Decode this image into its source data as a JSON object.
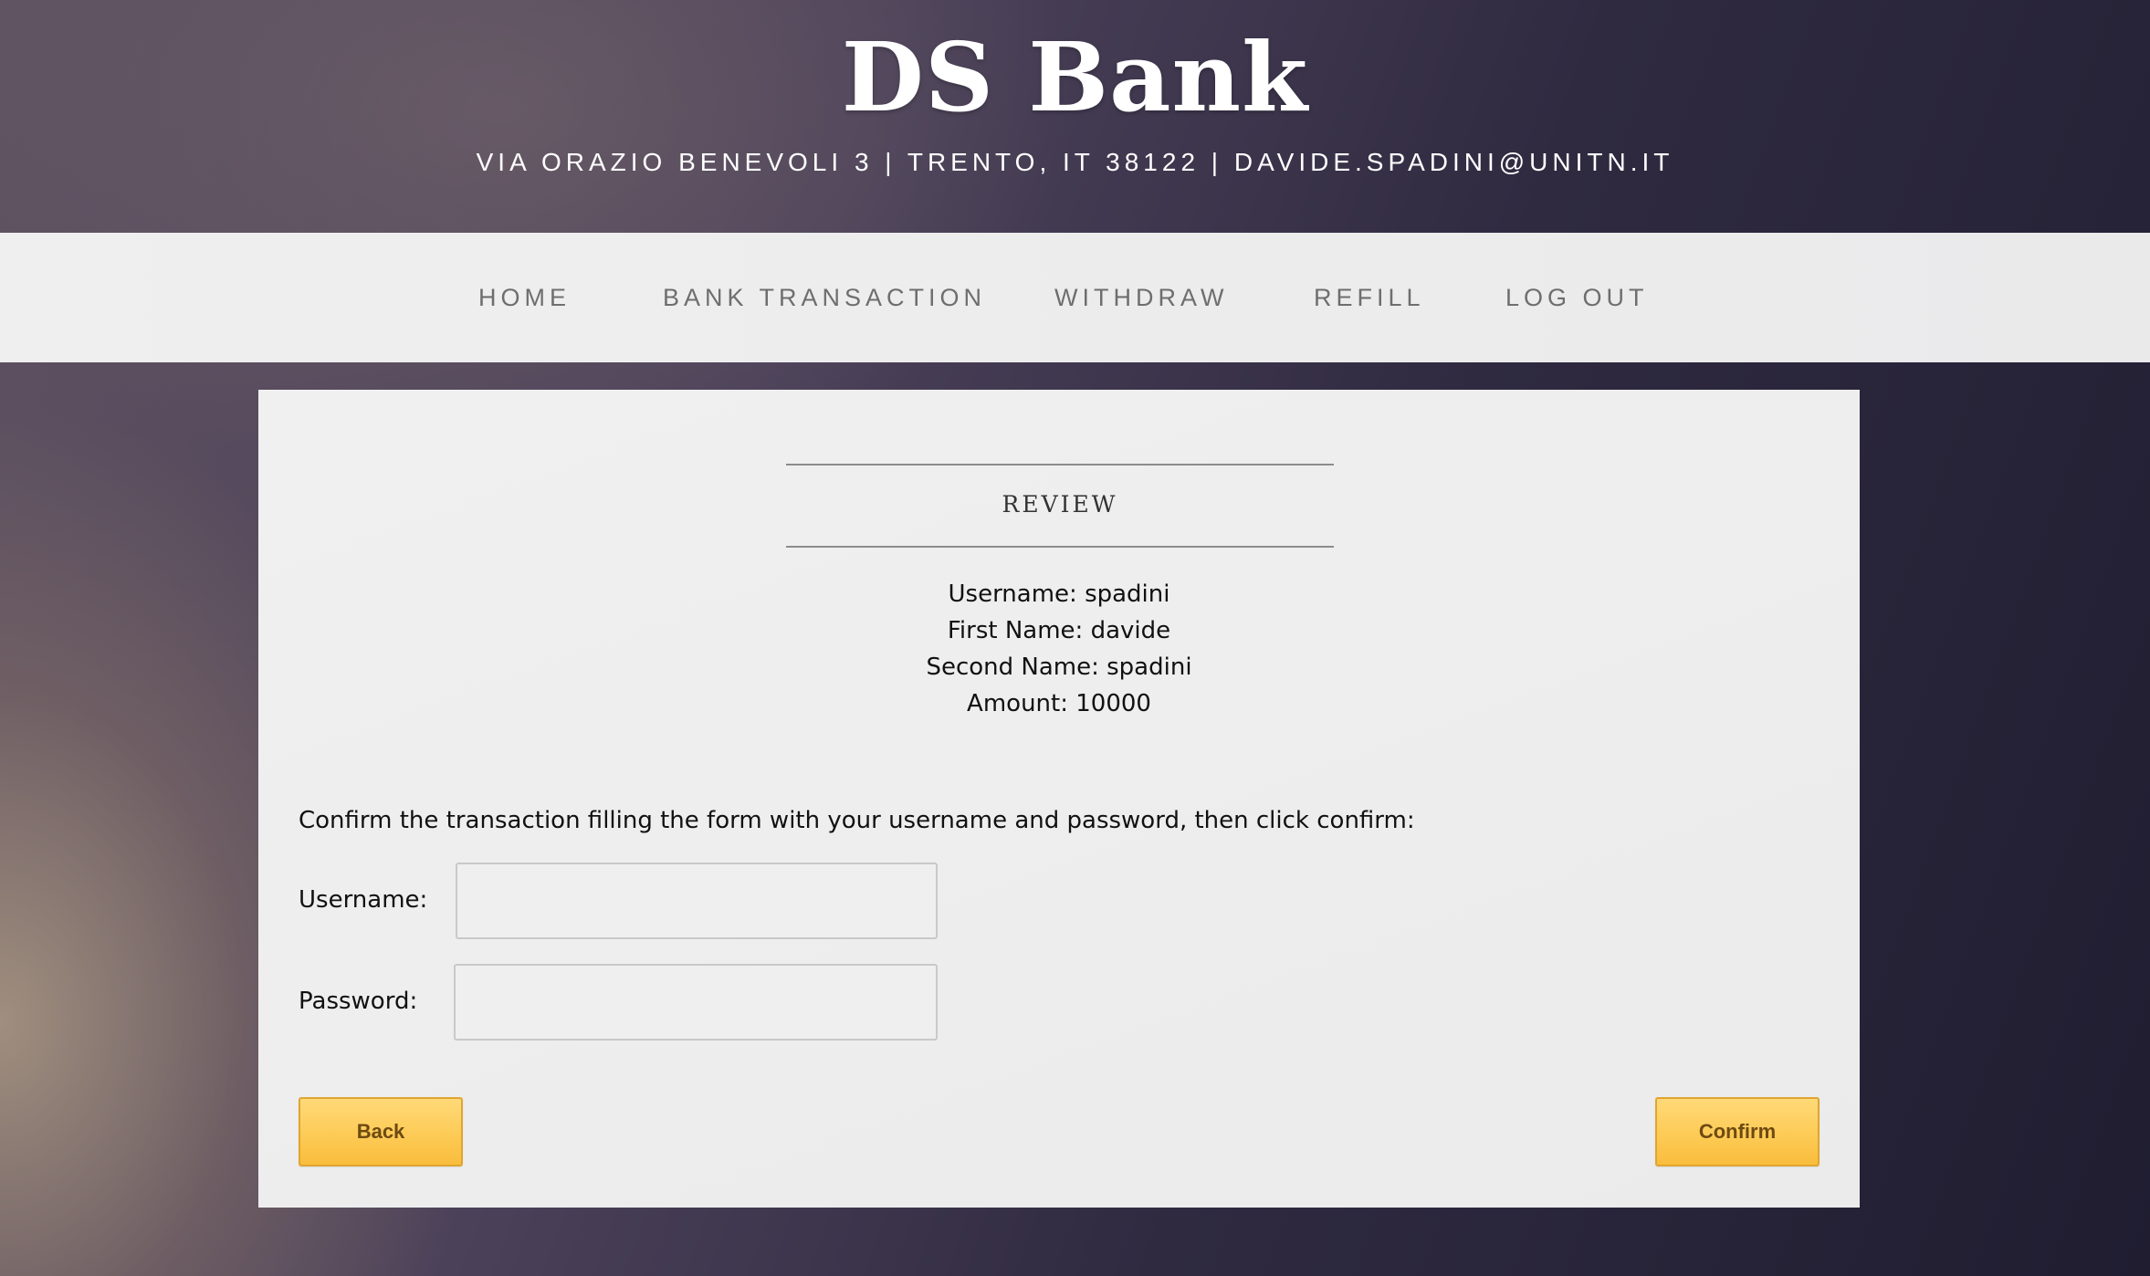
{
  "header": {
    "title": "DS Bank",
    "address": "VIA ORAZIO BENEVOLI 3 | TRENTO, IT 38122 | DAVIDE.SPADINI@UNITN.IT"
  },
  "nav": {
    "items": [
      {
        "label": "HOME"
      },
      {
        "label": "BANK TRANSACTION"
      },
      {
        "label": "WITHDRAW"
      },
      {
        "label": "REFILL"
      },
      {
        "label": "LOG OUT"
      }
    ]
  },
  "review": {
    "title": "REVIEW",
    "lines": [
      "Username: spadini",
      "First Name: davide",
      "Second Name: spadini",
      "Amount: 10000"
    ]
  },
  "form": {
    "instruction": "Confirm the transaction filling the form with your username and password, then click confirm:",
    "username_label": "Username:",
    "username_value": "",
    "password_label": "Password:",
    "password_value": ""
  },
  "buttons": {
    "back_label": "Back",
    "confirm_label": "Confirm"
  },
  "colors": {
    "button_fill": "#fdcb56",
    "button_text": "#6e4a12",
    "nav_text": "#6e6e6e"
  }
}
